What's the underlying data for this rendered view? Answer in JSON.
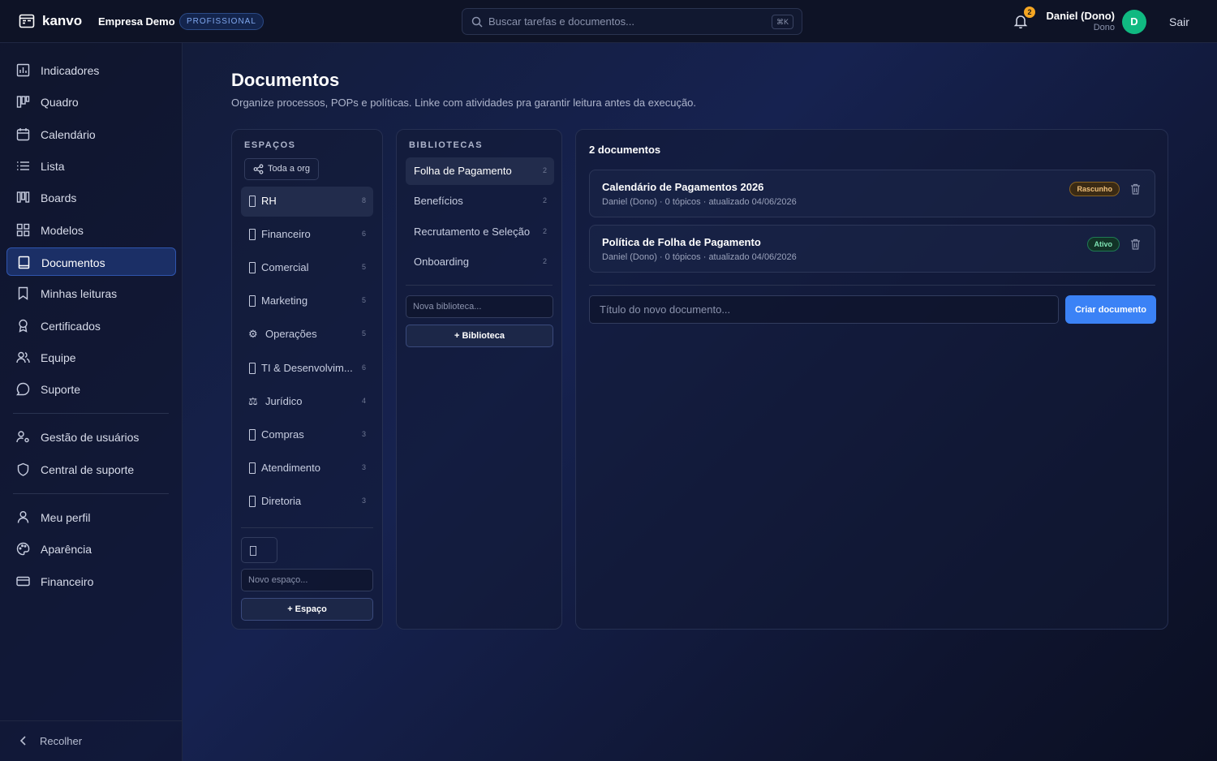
{
  "app": {
    "name": "kanvo",
    "org_name": "Empresa Demo",
    "plan": "PROFISSIONAL",
    "accent_color": "#3b82f6",
    "avatar_color": "#10b981"
  },
  "header": {
    "search_placeholder": "Buscar tarefas e documentos...",
    "search_shortcut": "⌘K",
    "notification_count": "2",
    "user_name": "Daniel (Dono)",
    "user_role": "Dono",
    "avatar_initial": "D",
    "logout_label": "Sair"
  },
  "sidebar": {
    "items": [
      {
        "label": "Indicadores",
        "icon": "bar-chart-icon"
      },
      {
        "label": "Quadro",
        "icon": "kanban-icon"
      },
      {
        "label": "Calendário",
        "icon": "calendar-icon"
      },
      {
        "label": "Lista",
        "icon": "list-icon"
      },
      {
        "label": "Boards",
        "icon": "boards-icon"
      },
      {
        "label": "Modelos",
        "icon": "grid-icon"
      },
      {
        "label": "Documentos",
        "icon": "book-icon",
        "active": true
      },
      {
        "label": "Minhas leituras",
        "icon": "bookmark-icon"
      },
      {
        "label": "Certificados",
        "icon": "award-icon"
      },
      {
        "label": "Equipe",
        "icon": "users-icon"
      },
      {
        "label": "Suporte",
        "icon": "chat-icon"
      }
    ],
    "admin_items": [
      {
        "label": "Gestão de usuários",
        "icon": "user-cog-icon"
      },
      {
        "label": "Central de suporte",
        "icon": "shield-icon"
      }
    ],
    "account_items": [
      {
        "label": "Meu perfil",
        "icon": "user-icon"
      },
      {
        "label": "Aparência",
        "icon": "palette-icon"
      },
      {
        "label": "Financeiro",
        "icon": "credit-card-icon"
      }
    ],
    "collapse_label": "Recolher"
  },
  "page": {
    "title": "Documentos",
    "subtitle": "Organize processos, POPs e políticas. Linke com atividades pra garantir leitura antes da execução."
  },
  "spaces": {
    "header": "ESPAÇOS",
    "org_filter_label": "Toda a org",
    "items": [
      {
        "label": "RH",
        "count": "8",
        "icon": "box",
        "active": true
      },
      {
        "label": "Financeiro",
        "count": "6",
        "icon": "box"
      },
      {
        "label": "Comercial",
        "count": "5",
        "icon": "box"
      },
      {
        "label": "Marketing",
        "count": "5",
        "icon": "box"
      },
      {
        "label": "Operações",
        "count": "5",
        "icon": "⚙"
      },
      {
        "label": "TI & Desenvolvim...",
        "count": "6",
        "icon": "box"
      },
      {
        "label": "Jurídico",
        "count": "4",
        "icon": "⚖"
      },
      {
        "label": "Compras",
        "count": "3",
        "icon": "box"
      },
      {
        "label": "Atendimento",
        "count": "3",
        "icon": "box"
      },
      {
        "label": "Diretoria",
        "count": "3",
        "icon": "box"
      }
    ],
    "new_placeholder": "Novo espaço...",
    "add_label": "+ Espaço"
  },
  "libraries": {
    "header": "BIBLIOTECAS",
    "items": [
      {
        "label": "Folha de Pagamento",
        "count": "2",
        "active": true
      },
      {
        "label": "Benefícios",
        "count": "2"
      },
      {
        "label": "Recrutamento e Seleção",
        "count": "2"
      },
      {
        "label": "Onboarding",
        "count": "2"
      }
    ],
    "new_placeholder": "Nova biblioteca...",
    "add_label": "+ Biblioteca"
  },
  "documents": {
    "count_label": "2 documentos",
    "items": [
      {
        "title": "Calendário de Pagamentos 2026",
        "meta": "Daniel (Dono) · 0 tópicos · atualizado 04/06/2026",
        "status": "Rascunho",
        "status_type": "draft"
      },
      {
        "title": "Política de Folha de Pagamento",
        "meta": "Daniel (Dono) · 0 tópicos · atualizado 04/06/2026",
        "status": "Ativo",
        "status_type": "active"
      }
    ],
    "new_title_placeholder": "Título do novo documento...",
    "create_label": "Criar documento"
  }
}
